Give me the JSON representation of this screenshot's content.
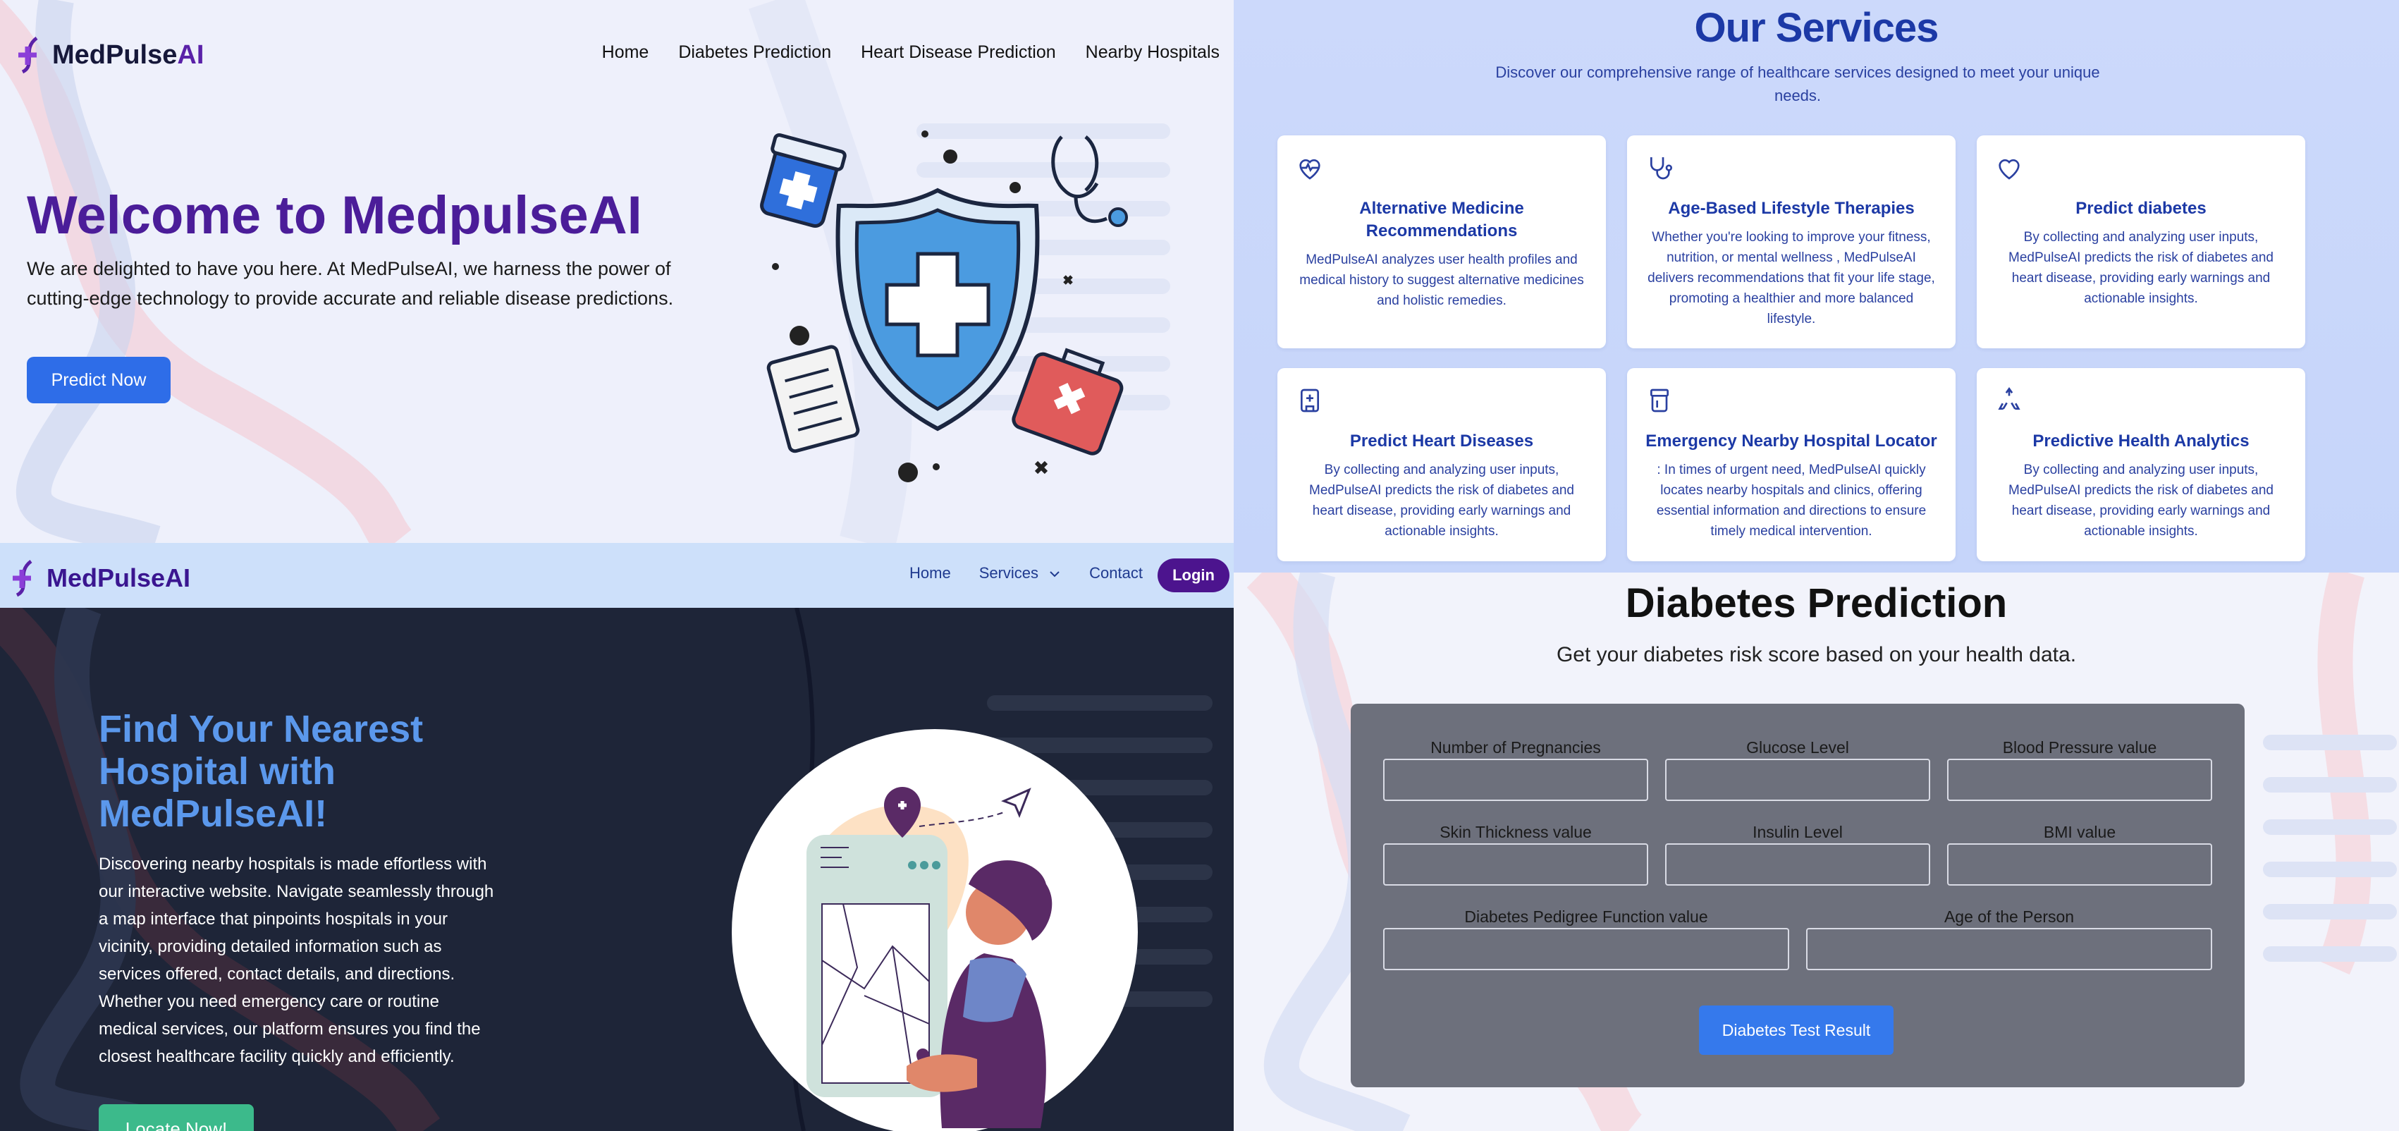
{
  "hero": {
    "brand_a": "MedPulse",
    "brand_b": "AI",
    "nav": [
      "Home",
      "Diabetes Prediction",
      "Heart Disease Prediction",
      "Nearby Hospitals"
    ],
    "title": "Welcome to MedpulseAI",
    "description": "We are delighted to have you here. At MedPulseAI, we harness the power of cutting-edge technology to provide accurate and reliable disease predictions.",
    "cta": "Predict Now"
  },
  "services": {
    "title": "Our Services",
    "subtitle": "Discover our comprehensive range of healthcare services designed to meet your unique needs.",
    "cards": [
      {
        "icon": "heart-pulse-icon",
        "title": "Alternative Medicine Recommendations",
        "text": "MedPulseAI analyzes user health profiles and medical history to suggest alternative medicines and holistic remedies."
      },
      {
        "icon": "stethoscope-icon",
        "title": "Age-Based Lifestyle Therapies",
        "text": "Whether you're looking to improve your fitness, nutrition, or mental wellness , MedPulseAI delivers recommendations that fit your life stage, promoting a healthier and more balanced lifestyle."
      },
      {
        "icon": "heart-icon",
        "title": "Predict diabetes",
        "text": "By collecting and analyzing user inputs, MedPulseAI predicts the risk of diabetes and heart disease, providing early warnings and actionable insights."
      },
      {
        "icon": "hospital-icon",
        "title": "Predict Heart Diseases",
        "text": "By collecting and analyzing user inputs, MedPulseAI predicts the risk of diabetes and heart disease, providing early warnings and actionable insights."
      },
      {
        "icon": "pill-bottle-icon",
        "title": "Emergency Nearby Hospital Locator",
        "text": ": In times of urgent need, MedPulseAI quickly locates nearby hospitals and clinics, offering essential information and directions to ensure timely medical intervention."
      },
      {
        "icon": "recycle-icon",
        "title": "Predictive Health Analytics",
        "text": "By collecting and analyzing user inputs, MedPulseAI predicts the risk of diabetes and heart disease, providing early warnings and actionable insights."
      }
    ]
  },
  "hospital": {
    "brand": "MedPulseAI",
    "nav": [
      "Home",
      "Services",
      "Contact"
    ],
    "login": "Login",
    "title": "Find Your Nearest Hospital with MedPulseAI!",
    "description": "Discovering nearby hospitals is made effortless with our interactive website. Navigate seamlessly through a map interface that pinpoints hospitals in your vicinity, providing detailed information such as services offered, contact details, and directions. Whether you need emergency care or routine medical services, our platform ensures you find the closest healthcare facility quickly and efficiently.",
    "cta": "Locate Now!"
  },
  "diabetes": {
    "title": "Diabetes Prediction",
    "subtitle": "Get your diabetes risk score based on your health data.",
    "fields": [
      "Number of Pregnancies",
      "Glucose Level",
      "Blood Pressure value",
      "Skin Thickness value",
      "Insulin Level",
      "BMI value",
      "Diabetes Pedigree Function value",
      "Age of the Person"
    ],
    "submit": "Diabetes Test Result"
  },
  "colors": {
    "brand_purple": "#4b1d99",
    "accent_blue": "#2e6de8",
    "service_blue": "#1c39a6",
    "dark_bg": "#1e2538",
    "locate_green": "#3cba8b"
  }
}
